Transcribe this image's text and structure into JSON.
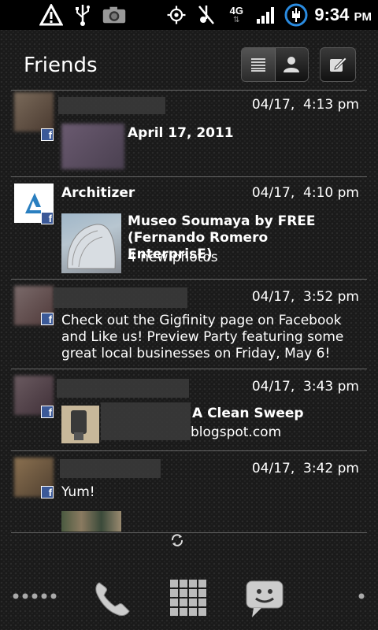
{
  "status_bar": {
    "time": "9:34",
    "ampm": "PM",
    "network": "4G",
    "icons": [
      "warning-icon",
      "usb-icon",
      "camera-icon",
      "gps-icon",
      "mute-icon",
      "network-icon",
      "signal-icon",
      "battery-icon"
    ]
  },
  "widget": {
    "title": "Friends",
    "items": [
      {
        "name": "",
        "time": "04/17,  4:13 pm",
        "headline": "April 17, 2011",
        "sub": ""
      },
      {
        "name": "Architizer",
        "time": "04/17,  4:10 pm",
        "headline": "Museo Soumaya by FREE (Fernando Romero EnterprisE)",
        "sub": "4 new photos"
      },
      {
        "name": "",
        "time": "04/17,  3:52 pm",
        "body": "Check out the Gigfinity page on Facebook and Like us! Preview Party featuring some great local businesses on Friday, May 6!"
      },
      {
        "name": "",
        "time": "04/17,  3:43 pm",
        "headline": "A Clean Sweep",
        "sub": "blogspot.com"
      },
      {
        "name": "",
        "time": "04/17,  3:42 pm",
        "body": "Yum!"
      }
    ]
  },
  "dock": {
    "items": [
      "launcher-dots-icon",
      "phone-icon",
      "app-drawer-icon",
      "messaging-icon",
      "dot-icon"
    ]
  },
  "colors": {
    "facebook": "#3b5998",
    "divider": "#666666"
  }
}
